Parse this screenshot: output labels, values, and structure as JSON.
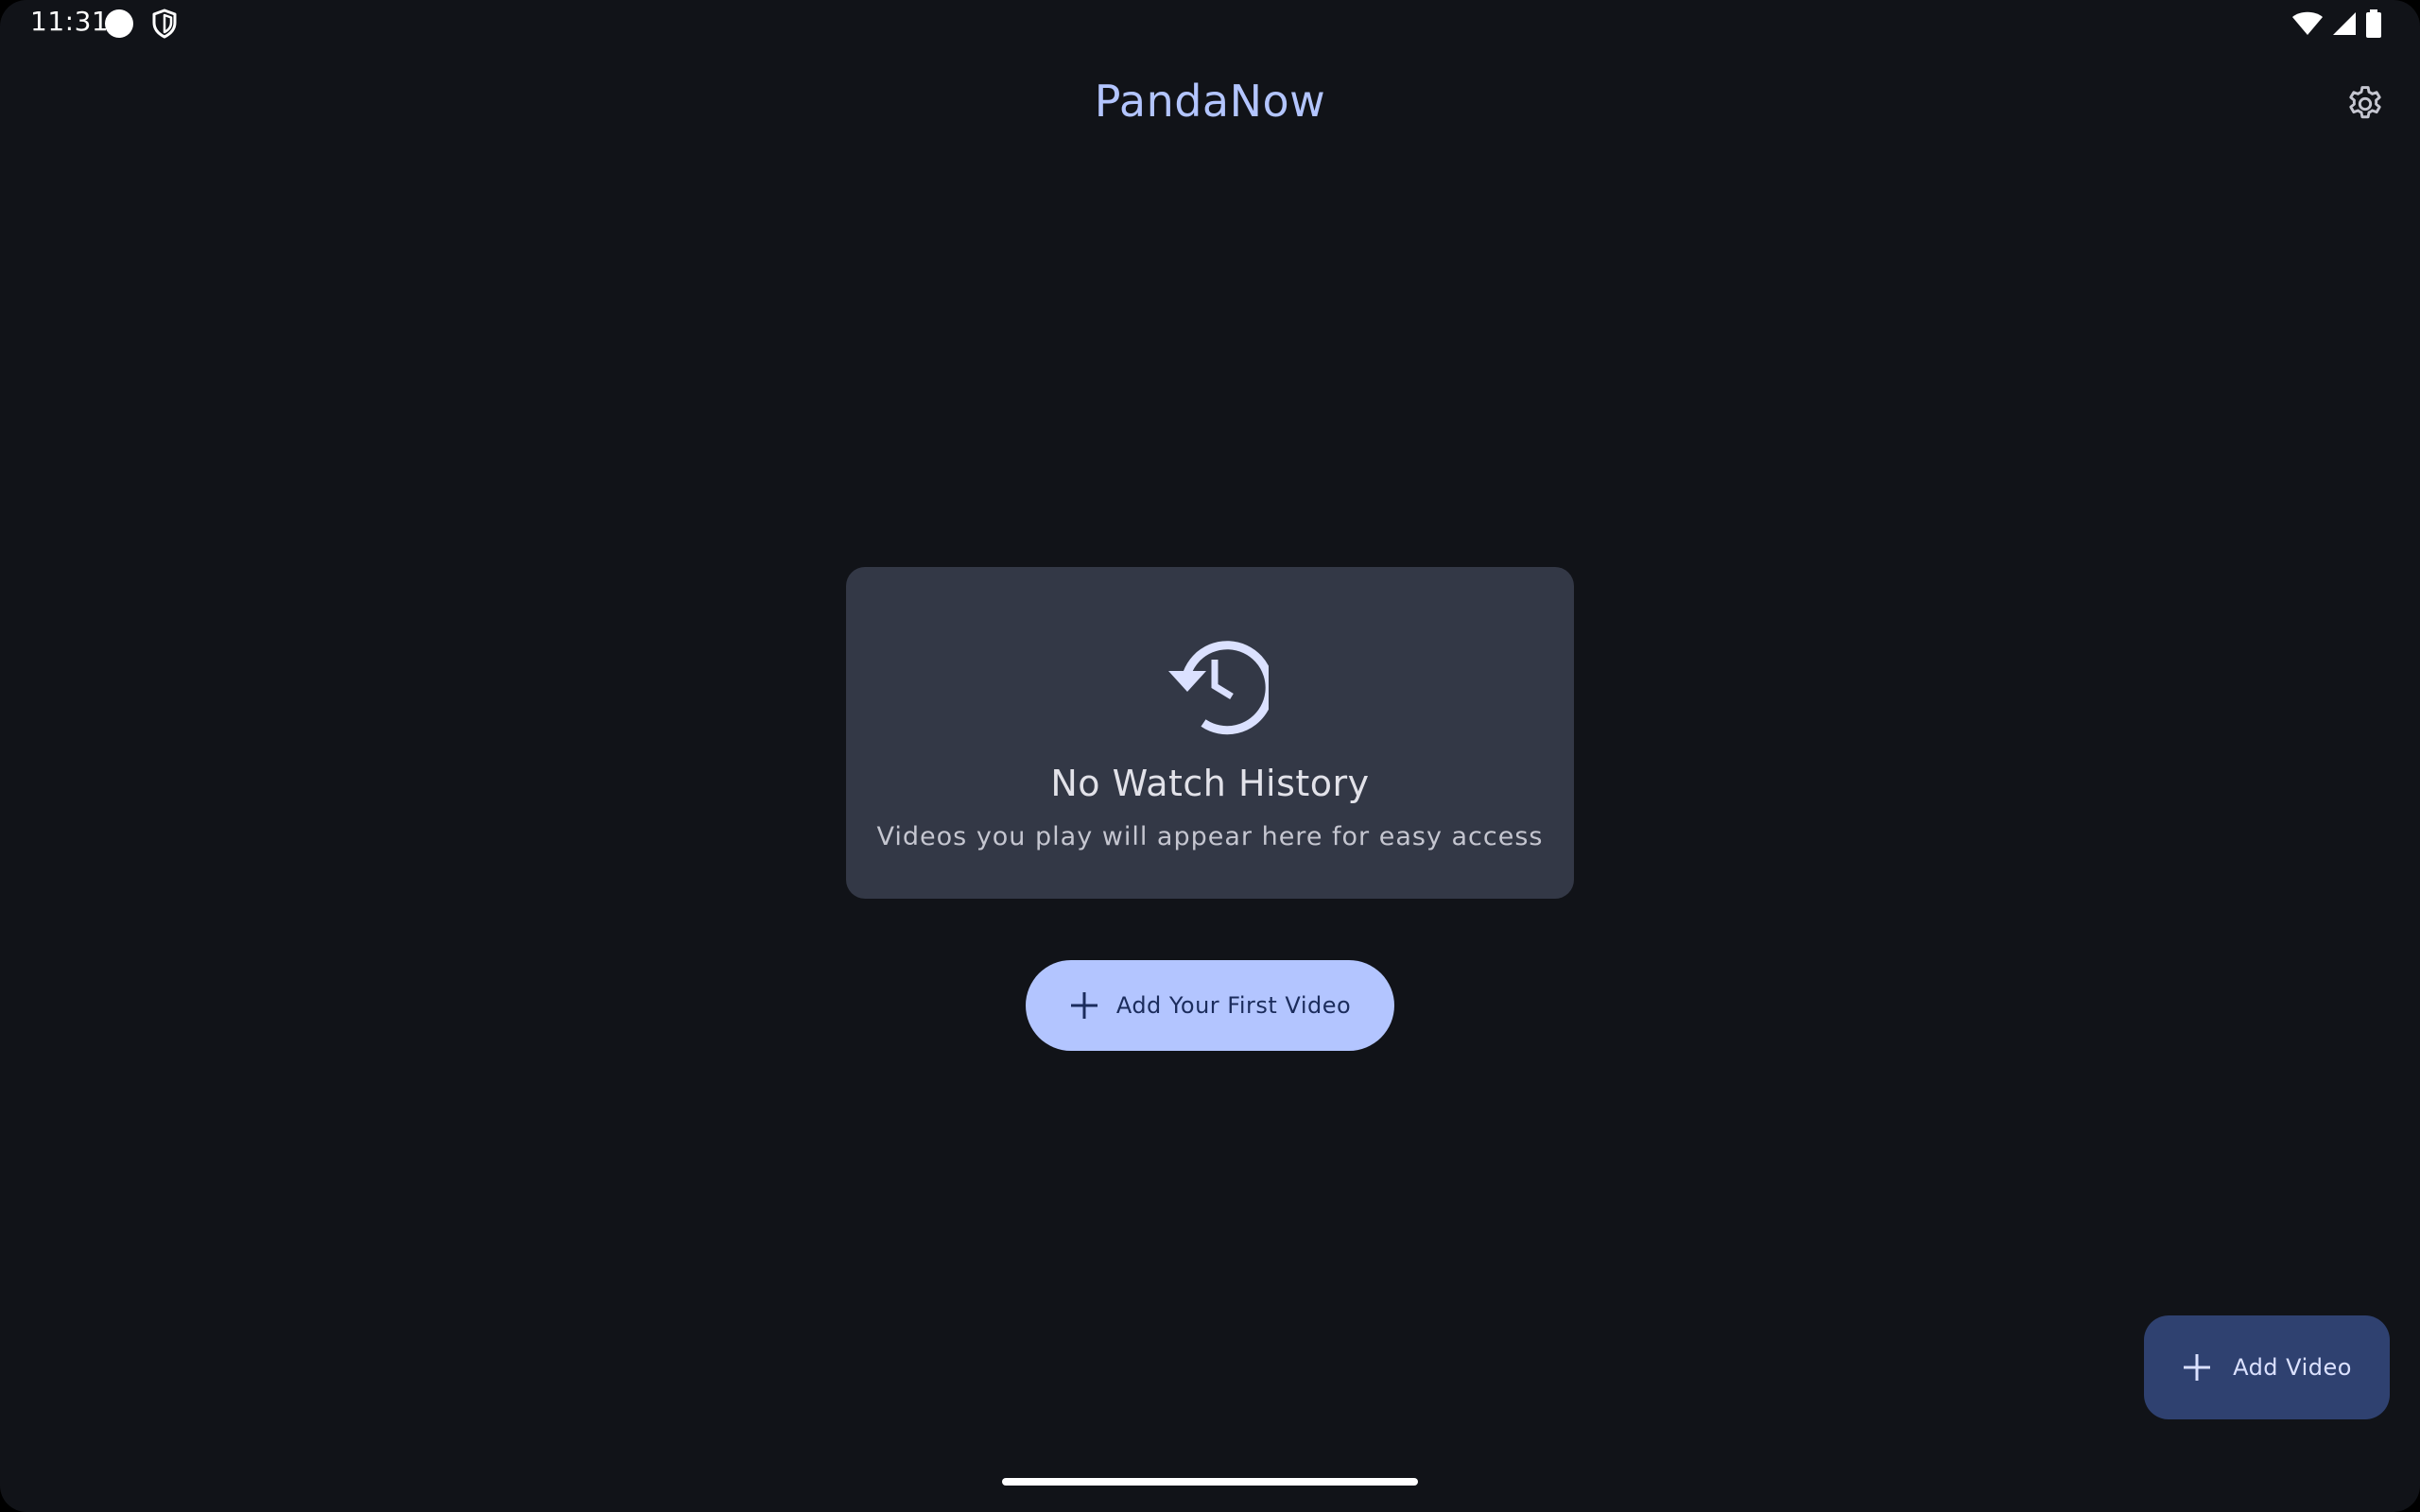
{
  "status_bar": {
    "time": "11:31",
    "icons": [
      "circle-notification-icon",
      "shield-icon",
      "wifi-icon",
      "signal-icon",
      "battery-icon"
    ]
  },
  "app_bar": {
    "title": "PandaNow",
    "settings_icon": "gear-icon"
  },
  "empty_state": {
    "icon": "history-icon",
    "title": "No Watch History",
    "subtitle": "Videos you play will appear here for easy access"
  },
  "primary_action": {
    "icon": "plus-icon",
    "label": "Add Your First Video"
  },
  "fab": {
    "icon": "plus-icon",
    "label": "Add Video"
  },
  "colors": {
    "background": "#111318",
    "card": "#333846",
    "accent": "#b3c5ff",
    "fab": "#2f4170"
  }
}
